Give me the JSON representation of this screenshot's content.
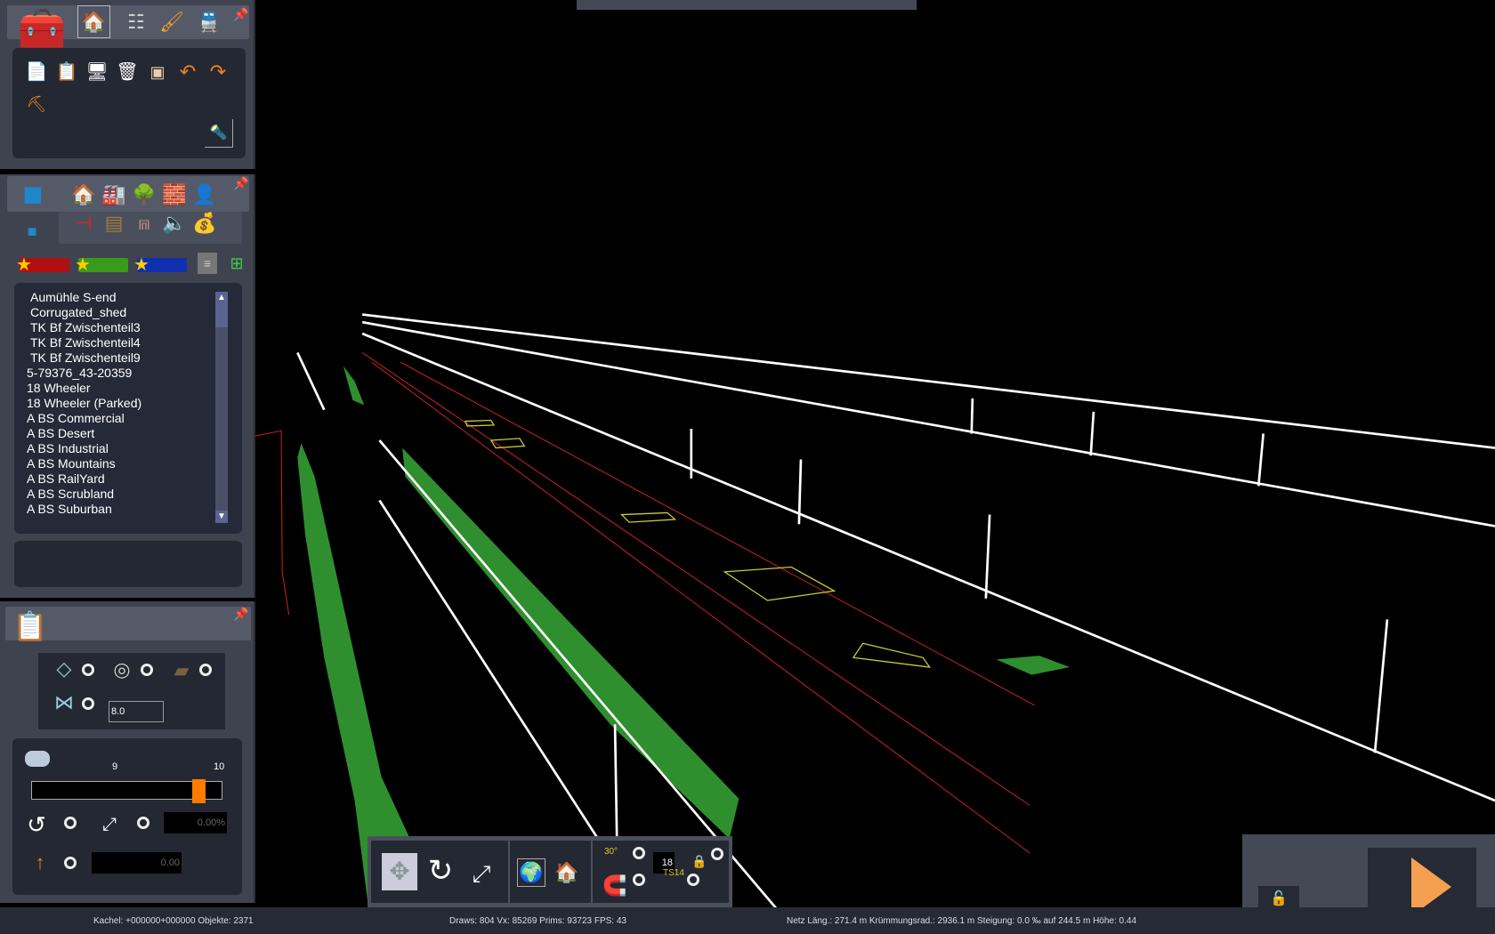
{
  "toolbox": {
    "tabs": [
      "home-icon",
      "track-icon",
      "brush-icon",
      "train-icon"
    ],
    "tools": [
      "copy-icon",
      "paste-icon",
      "monitor-icon",
      "trash-icon",
      "measure-icon",
      "undo-icon",
      "redo-icon",
      "track-tool-icon"
    ]
  },
  "objects": {
    "categories_row1": [
      "house-icon",
      "factory-icon",
      "tree-icon",
      "wall-icon",
      "person-icon"
    ],
    "categories_row2": [
      "signal-icon",
      "bench-icon",
      "bridge-icon",
      "speaker-icon",
      "sack-icon"
    ],
    "list": [
      "Aumühle S-end",
      "Corrugated_shed",
      "TK Bf Zwischenteil3",
      "TK Bf Zwischenteil4",
      "TK Bf Zwischenteil9",
      "5-79376_43-20359",
      "18 Wheeler",
      "18 Wheeler (Parked)",
      "A BS Commercial",
      "A BS Desert",
      "A BS Industrial",
      "A BS Mountains",
      "A BS RailYard",
      "A BS Scrubland",
      "A BS Suburban"
    ]
  },
  "properties": {
    "spacing_value": "8.0",
    "slider": {
      "min_label": "9",
      "max_label": "10",
      "value_fraction": 0.88
    },
    "scale_value": "0.00%",
    "height_value": "0.00"
  },
  "toolbar": {
    "snap_value": "18",
    "angle_label": "30°",
    "ts_label": "TS14"
  },
  "status": {
    "tile": "Kachel: +000000+000000  Objekte: 2371",
    "render": "Draws: 804 Vx: 85269 Prims: 93723 FPS: 43",
    "network": "Netz  Läng.:  271.4 m Krümmungsrad.: 2936.1 m Steigung:  0.0 ‰ auf 244.5 m Höhe:   0.44"
  },
  "colors": {
    "accent": "#ff7a00",
    "track": "#2e8b2e"
  }
}
